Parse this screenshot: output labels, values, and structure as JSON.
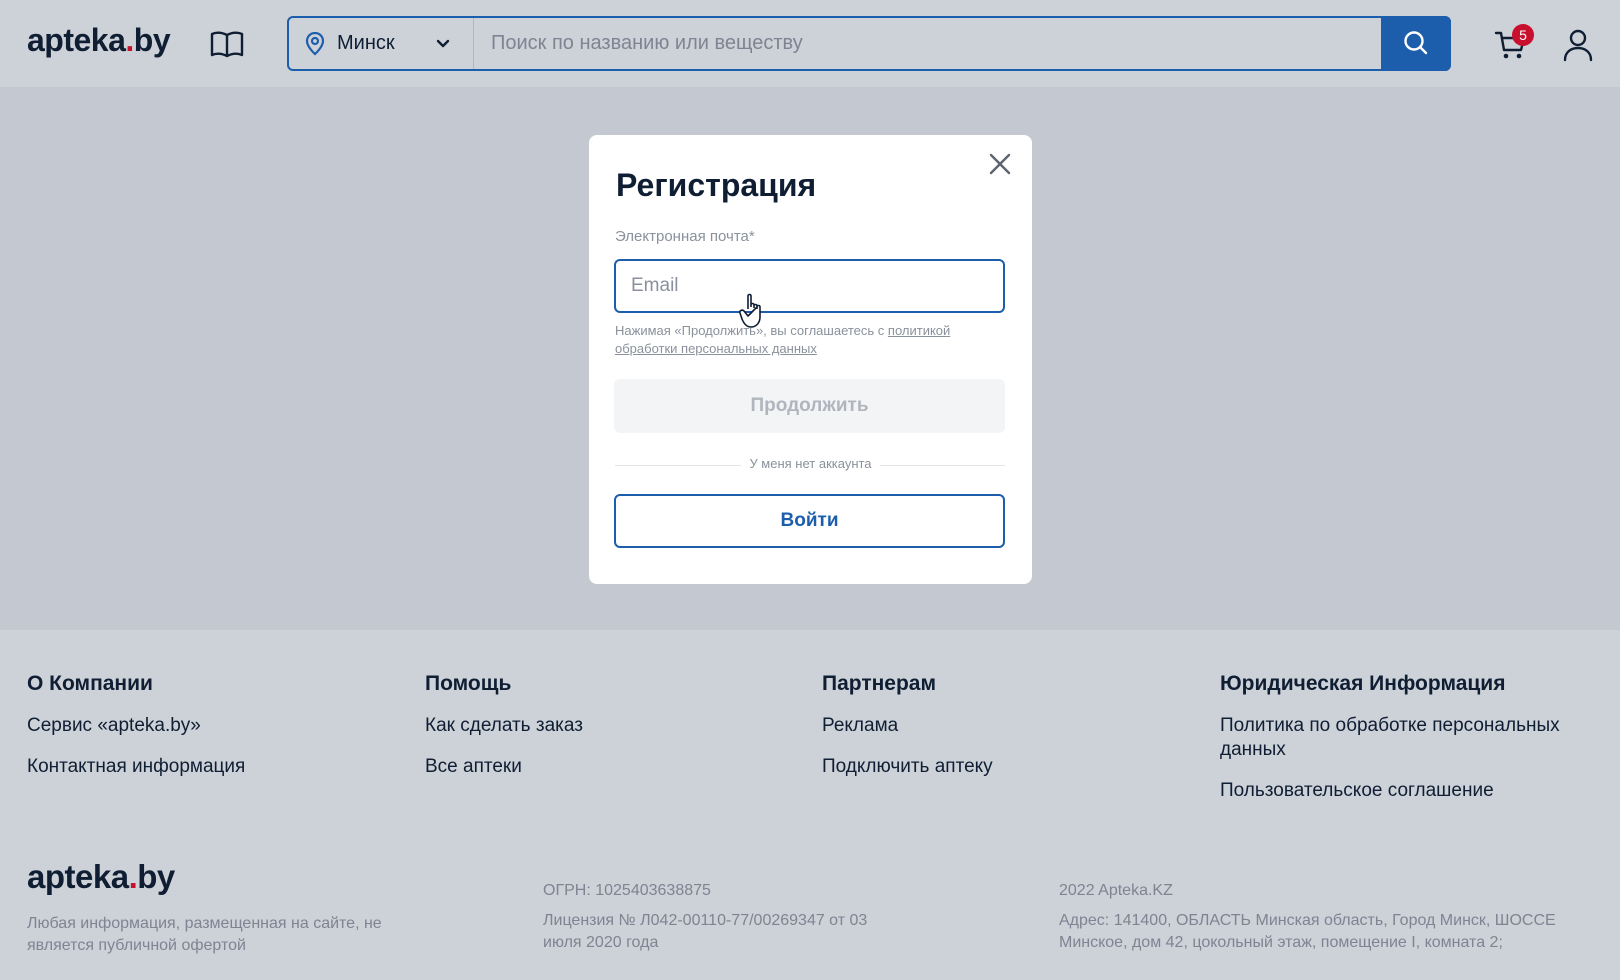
{
  "header": {
    "logo_main": "apteka",
    "logo_dot": ".",
    "logo_tail": "by",
    "city": "Минск",
    "search_placeholder": "Поиск по названию или веществу",
    "cart_count": "5"
  },
  "icons": {
    "book": "book-icon",
    "pin": "location-pin-icon",
    "chevron": "chevron-down-icon",
    "search": "search-icon",
    "cart": "cart-icon",
    "user": "user-icon",
    "close": "close-icon",
    "cursor": "hand-cursor-icon"
  },
  "colors": {
    "accent": "#1c5eab",
    "brand_dot": "#c8102e",
    "overlay": "#c4c8d0"
  },
  "modal": {
    "title": "Регистрация",
    "email_label": "Электронная почта*",
    "email_placeholder": "Email",
    "agree_text": "Нажимая «Продолжить», вы соглашаетесь с ",
    "agree_link": "политикой обработки персональных данных",
    "continue_label": "Продолжить",
    "divider_text": "У меня нет аккаунта",
    "login_label": "Войти"
  },
  "footer": {
    "columns": [
      {
        "title": "О Компании",
        "links": [
          "Сервис «apteka.by»",
          "Контактная информация"
        ]
      },
      {
        "title": "Помощь",
        "links": [
          "Как сделать заказ",
          "Все аптеки"
        ]
      },
      {
        "title": "Партнерам",
        "links": [
          "Реклама",
          "Подключить аптеку"
        ]
      },
      {
        "title": "Юридическая Информация",
        "links": [
          "Политика по обработке персональных данных",
          "Пользовательское соглашение"
        ]
      }
    ],
    "disclaimer": "Любая информация, размещенная на сайте, не является публичной офертой",
    "ogrn": "ОГРН: 1025403638875",
    "license": "Лицензия № Л042-00110-77/00269347 от 03 июля 2020 года",
    "copyright": "2022 Apteka.KZ",
    "address": "Адрес: 141400, ОБЛАСТЬ Минская область, Город Минск, ШОССЕ Минское, дом 42, цокольный этаж, помещение I, комната 2;"
  }
}
